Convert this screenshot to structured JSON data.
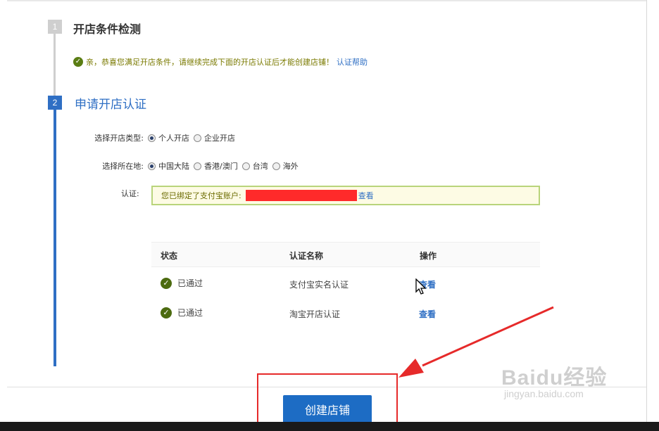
{
  "steps": {
    "step1": {
      "number": "1",
      "title": "开店条件检测"
    },
    "step2": {
      "number": "2",
      "title": "申请开店认证"
    }
  },
  "notice": {
    "text": "亲，恭喜您满足开店条件，请继续完成下面的开店认证后才能创建店铺！",
    "help_link": "认证帮助"
  },
  "form": {
    "shop_type": {
      "label": "选择开店类型:",
      "options": [
        "个人开店",
        "企业开店"
      ],
      "selected": "个人开店"
    },
    "location": {
      "label": "选择所在地:",
      "options": [
        "中国大陆",
        "香港/澳门",
        "台湾",
        "海外"
      ],
      "selected": "中国大陆"
    },
    "auth": {
      "label": "认证:",
      "text": "您已绑定了支付宝账户:",
      "view_link": "查看"
    }
  },
  "table": {
    "headers": [
      "状态",
      "认证名称",
      "操作"
    ],
    "rows": [
      {
        "status": "已通过",
        "name": "支付宝实名认证",
        "action": "查看"
      },
      {
        "status": "已通过",
        "name": "淘宝开店认证",
        "action": "查看"
      }
    ]
  },
  "create_button": "创建店铺",
  "colors": {
    "accent_blue": "#2f6fc4",
    "success_green": "#4c6b10",
    "highlight_red": "#e62a2a",
    "notice_bg": "#fdfbe4"
  },
  "watermark": {
    "logo": "Baidu经验",
    "url": "jingyan.baidu.com"
  }
}
